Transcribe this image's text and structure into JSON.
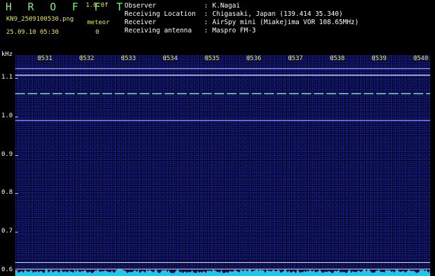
{
  "header": {
    "app_title": "H R O F F T",
    "version": "1.0.0f",
    "filename": "KN9_2509100530.png",
    "meteor_label": "meteor",
    "timestamp": "25.09.10 05:30",
    "meteor_count": "0"
  },
  "station_info": [
    {
      "key": "Observer",
      "value": "K.Nagai"
    },
    {
      "key": "Receiving Location",
      "value": "Chigasaki, Japan (139.414 35.340)"
    },
    {
      "key": "Receiver",
      "value": "AirSpy mini (Miakejima VOR 108.65MHz)"
    },
    {
      "key": "Receiving antenna",
      "value": "Maspro FM-3"
    }
  ],
  "info_separator": ":",
  "plot": {
    "unit": "kHz",
    "time_labels": [
      "0531",
      "0532",
      "0533",
      "0534",
      "0535",
      "0536",
      "0537",
      "0538",
      "0539",
      "0540"
    ],
    "freq_labels": [
      "1.1",
      "1.0",
      "0.9",
      "0.8",
      "0.7",
      "0.6"
    ],
    "freq_range_khz": [
      0.585,
      1.16
    ],
    "carrier_lines_khz": [
      {
        "freq": 1.125,
        "color": "#7d86ff"
      },
      {
        "freq": 1.108,
        "color": "#b9bdff"
      },
      {
        "freq": 1.06,
        "color": "#6fdcb8"
      },
      {
        "freq": 0.99,
        "color": "#7d86ff"
      },
      {
        "freq": 0.62,
        "color": "#d8d8ff"
      },
      {
        "freq": 0.603,
        "color": "#e8e8ff"
      }
    ],
    "spectrum_color": "#1fc8e8"
  }
}
